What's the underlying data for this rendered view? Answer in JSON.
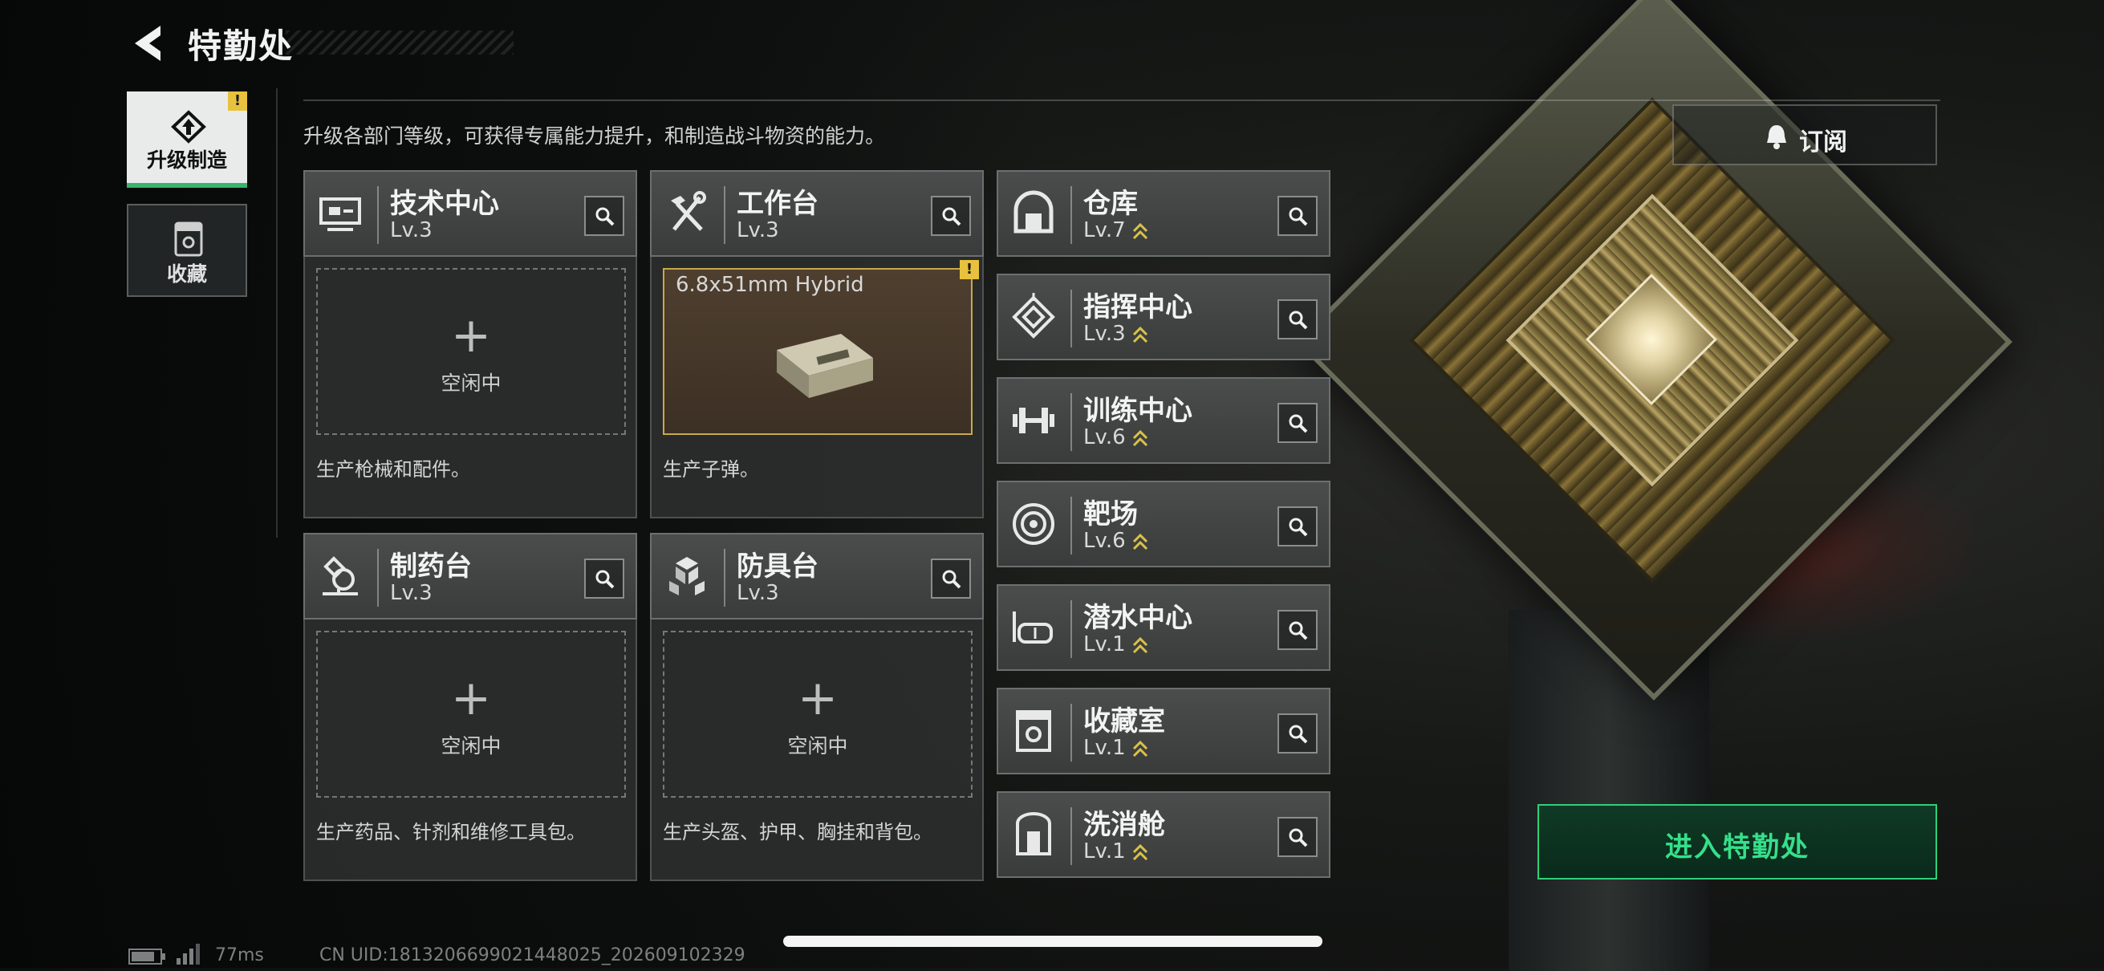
{
  "header": {
    "title": "特勤处",
    "subtitle": "升级各部门等级，可获得专属能力提升，和制造战斗物资的能力。"
  },
  "sidebar": {
    "tabs": [
      {
        "label": "升级制造",
        "icon": "upgrade-craft-icon",
        "active": true,
        "badge": "!"
      },
      {
        "label": "收藏",
        "icon": "collection-icon",
        "active": false
      }
    ]
  },
  "stations": [
    {
      "name": "技术中心",
      "level": "Lv.3",
      "icon": "tech-center-icon",
      "status": "空闲中",
      "plus": "+",
      "desc": "生产枪械和配件。"
    },
    {
      "name": "工作台",
      "level": "Lv.3",
      "icon": "workbench-icon",
      "producing": "6.8x51mm Hybrid",
      "badge": "!",
      "desc": "生产子弹。"
    },
    {
      "name": "制药台",
      "level": "Lv.3",
      "icon": "pharmacy-icon",
      "status": "空闲中",
      "plus": "+",
      "desc": "生产药品、针剂和维修工具包。"
    },
    {
      "name": "防具台",
      "level": "Lv.3",
      "icon": "armor-bench-icon",
      "status": "空闲中",
      "plus": "+",
      "desc": "生产头盔、护甲、胸挂和背包。"
    }
  ],
  "facilities": [
    {
      "name": "仓库",
      "level": "Lv.7",
      "icon": "warehouse-icon"
    },
    {
      "name": "指挥中心",
      "level": "Lv.3",
      "icon": "command-center-icon"
    },
    {
      "name": "训练中心",
      "level": "Lv.6",
      "icon": "dumbbell-icon"
    },
    {
      "name": "靶场",
      "level": "Lv.6",
      "icon": "target-icon"
    },
    {
      "name": "潜水中心",
      "level": "Lv.1",
      "icon": "diving-mask-icon"
    },
    {
      "name": "收藏室",
      "level": "Lv.1",
      "icon": "collection-room-icon"
    },
    {
      "name": "洗消舱",
      "level": "Lv.1",
      "icon": "decontamination-icon"
    }
  ],
  "actions": {
    "subscribe_label": "订阅",
    "enter_label": "进入特勤处"
  },
  "footer": {
    "ping": "77ms",
    "uid": "CN UID:1813206699021448025_202609102329"
  },
  "colors": {
    "accent_green": "#35e08a",
    "warning_yellow": "#e8c23e",
    "level_up_chevron": "#d9c24a"
  }
}
